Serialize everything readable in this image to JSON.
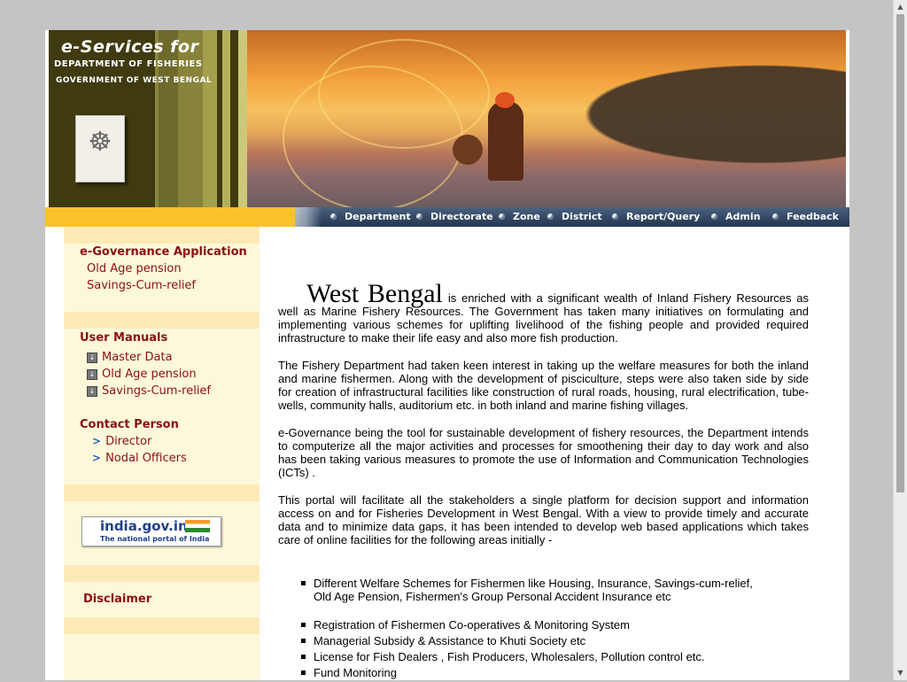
{
  "banner": {
    "title": "e-Services for",
    "line1": "DEPARTMENT OF FISHERIES",
    "line2": "GOVERNMENT OF WEST BENGAL"
  },
  "nav": {
    "items": [
      "Department",
      "Directorate",
      "Zone",
      "District",
      "Report/Query",
      "Admin",
      "Feedback"
    ]
  },
  "sidebar": {
    "egov_heading": "e-Governance Application",
    "egov_links": [
      "Old Age pension",
      "Savings-Cum-relief"
    ],
    "manuals_heading": "User Manuals",
    "manuals_links": [
      "Master Data",
      "Old Age pension",
      "Savings-Cum-relief"
    ],
    "contact_heading": "Contact Person",
    "contact_links": [
      "Director",
      "Nodal Officers"
    ],
    "india_portal_top": "india.gov.in",
    "india_portal_sub": "The national portal of India",
    "disclaimer": "Disclaimer"
  },
  "content": {
    "lead_big": "West Bengal",
    "lead_rest": "is enriched with a significant wealth of Inland Fishery Resources as well as Marine Fishery Resources. The Government has taken many initiatives on formulating and implementing various schemes for uplifting livelihood of the fishing people and provided required infrastructure to make their life easy and also more fish production.",
    "para2": "The Fishery Department had taken keen interest in taking up the welfare measures for both the inland and marine fishermen. Along with the development of pisciculture, steps were also taken side by side for creation of infrastructural facilities like construction of rural roads, housing, rural electrification, tube-wells, community halls, auditorium etc. in both inland and marine fishing villages.",
    "para3": "e-Governance being the tool for sustainable development of fishery resources, the Department intends to computerize all the major activities and processes for smoothening their day to day work and also has been taking various measures to promote the use of Information and Communication Technologies (ICTs) .",
    "para4": "This portal will facilitate all the stakeholders a single platform  for decision support and information access on and for Fisheries Development in West Bengal. With a view to provide timely and accurate data and to minimize data gaps, it has been intended  to develop web based applications which takes care of online facilities for the following areas initially -",
    "bullets": [
      "Different Welfare Schemes for Fishermen like Housing, Insurance, Savings-cum-relief,",
      "Old Age Pension, Fishermen's Group Personal Accident Insurance etc",
      "Registration of Fishermen Co-operatives & Monitoring System",
      "Managerial Subsidy &  Assistance to Khuti Society  etc",
      "License for Fish Dealers , Fish Producers, Wholesalers, Pollution control  etc.",
      "Fund Monitoring"
    ]
  }
}
